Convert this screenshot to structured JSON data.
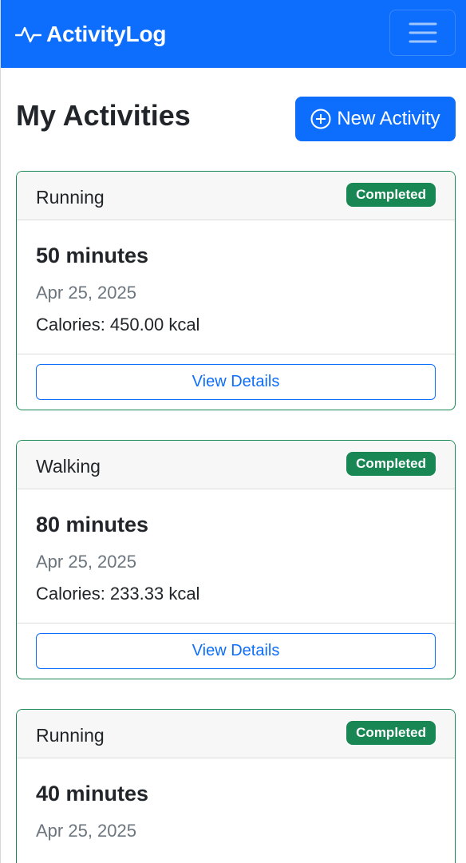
{
  "navbar": {
    "brand": "ActivityLog",
    "brand_icon": "activity-pulse-icon",
    "menu_icon": "hamburger-menu-icon",
    "color": "#0d6efd"
  },
  "header": {
    "title": "My Activities",
    "new_button_label": "New Activity",
    "new_button_icon": "plus-circle-icon"
  },
  "activities": [
    {
      "type": "Running",
      "status": "Completed",
      "duration": "50 minutes",
      "date": "Apr 25, 2025",
      "calories": "Calories: 450.00 kcal",
      "details_label": "View Details"
    },
    {
      "type": "Walking",
      "status": "Completed",
      "duration": "80 minutes",
      "date": "Apr 25, 2025",
      "calories": "Calories: 233.33 kcal",
      "details_label": "View Details"
    },
    {
      "type": "Running",
      "status": "Completed",
      "duration": "40 minutes",
      "date": "Apr 25, 2025",
      "calories": "",
      "details_label": ""
    }
  ],
  "colors": {
    "primary": "#0d6efd",
    "success": "#198754",
    "muted": "#6c757d"
  }
}
